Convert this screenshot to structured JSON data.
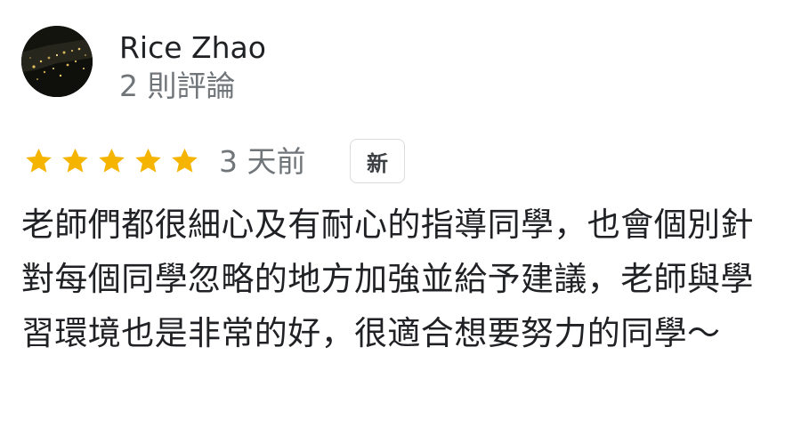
{
  "reviewer": {
    "name": "Rice Zhao",
    "review_count": "2 則評論",
    "avatar_icon": "avatar-night-city-photo"
  },
  "rating": {
    "stars": 5,
    "max_stars": 5,
    "star_color": "#f4b400",
    "date": "3 天前",
    "badge": "新"
  },
  "review": {
    "text": "老師們都很細心及有耐心的指導同學，也會個別針對每個同學忽略的地方加強並給予建議，老師與學習環境也是非常的好，很適合想要努力的同學～"
  }
}
